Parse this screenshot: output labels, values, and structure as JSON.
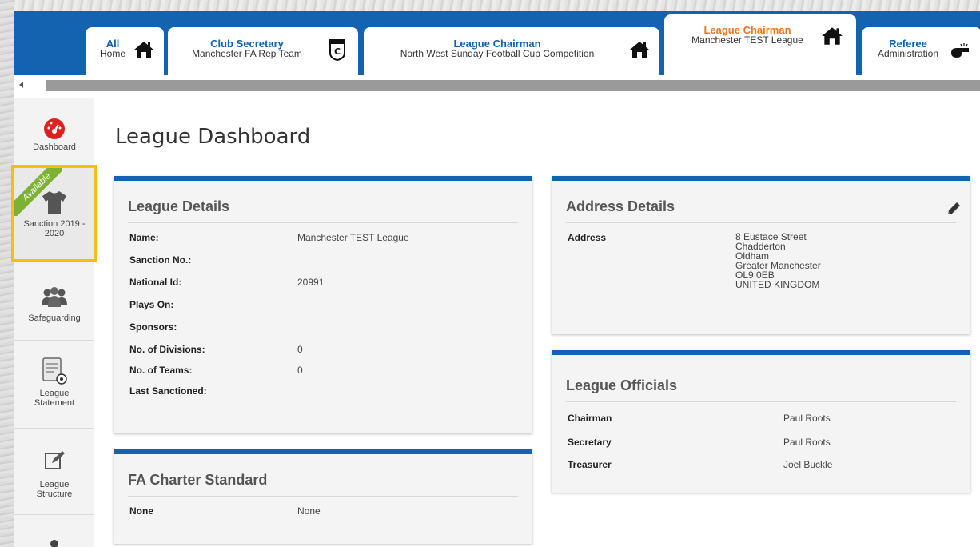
{
  "tabs": [
    {
      "title": "All",
      "subtitle": "Home",
      "icon": "home-icon"
    },
    {
      "title": "Club Secretary",
      "subtitle": "Manchester FA Rep Team",
      "icon": "club-badge-icon"
    },
    {
      "title": "League Chairman",
      "subtitle": "North West Sunday Football Cup Competition",
      "icon": "home-icon"
    },
    {
      "title": "League Chairman",
      "subtitle": "Manchester TEST League",
      "icon": "home-icon",
      "active": true
    },
    {
      "title": "Referee",
      "subtitle": "Administration",
      "icon": "whistle-icon"
    }
  ],
  "sidebar": {
    "items": [
      {
        "label": "Dashboard",
        "icon": "dashboard-gauge-icon"
      },
      {
        "label": "Sanction 2019 - 2020",
        "icon": "shirt-icon",
        "badge": "Available"
      },
      {
        "label": "Safeguarding",
        "icon": "people-icon"
      },
      {
        "label": "League Statement",
        "icon": "document-football-icon"
      },
      {
        "label": "League Structure",
        "icon": "edit-icon"
      }
    ]
  },
  "page": {
    "title": "League Dashboard"
  },
  "league_details": {
    "title": "League Details",
    "rows": [
      {
        "label": "Name:",
        "value": "Manchester TEST League"
      },
      {
        "label": "Sanction No.:",
        "value": ""
      },
      {
        "label": "National Id:",
        "value": "20991"
      },
      {
        "label": "Plays On:",
        "value": ""
      },
      {
        "label": "Sponsors:",
        "value": ""
      },
      {
        "label": "No. of Divisions:",
        "value": "0"
      },
      {
        "label": "No. of Teams:",
        "value": "0"
      },
      {
        "label": "Last Sanctioned:",
        "value": ""
      }
    ]
  },
  "charter": {
    "title": "FA Charter Standard",
    "label": "None",
    "value": "None"
  },
  "address": {
    "title": "Address Details",
    "label": "Address",
    "lines": [
      "8 Eustace Street",
      "Chadderton",
      "Oldham",
      "Greater Manchester",
      "OL9 0EB",
      "UNITED KINGDOM"
    ]
  },
  "officials": {
    "title": "League Officials",
    "rows": [
      {
        "label": "Chairman",
        "value": "Paul Roots"
      },
      {
        "label": "Secretary",
        "value": "Paul Roots"
      },
      {
        "label": "Treasurer",
        "value": "Joel Buckle"
      }
    ]
  },
  "colors": {
    "brand": "#1363b0",
    "active_tab": "#e87722",
    "highlight": "#f6bd17",
    "badge": "#7bb234"
  }
}
